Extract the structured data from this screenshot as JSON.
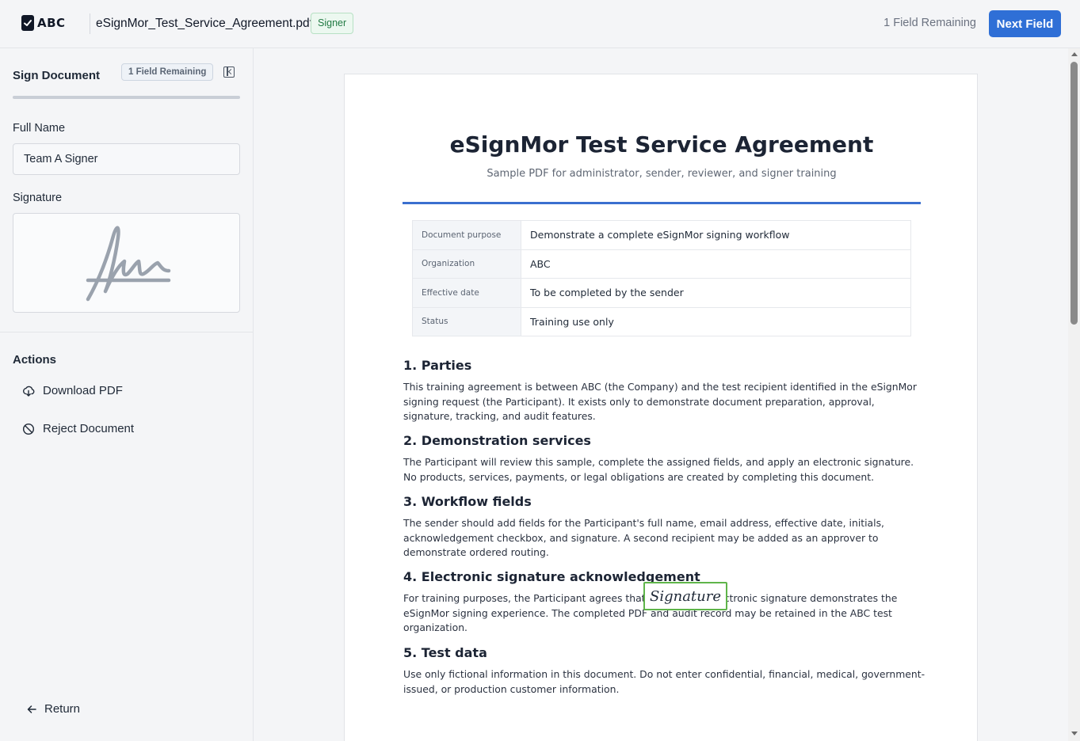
{
  "header": {
    "logo_text": "ABC",
    "filename": "eSignMor_Test_Service_Agreement.pdf",
    "role_badge": "Signer",
    "fields_remaining": "1 Field Remaining",
    "next_field_label": "Next Field"
  },
  "sidebar": {
    "title": "Sign Document",
    "remaining_badge": "1 Field Remaining",
    "full_name_label": "Full Name",
    "full_name_value": "Team A Signer",
    "signature_label": "Signature",
    "actions_title": "Actions",
    "actions": [
      {
        "label": "Download PDF",
        "icon": "download-cloud-icon"
      },
      {
        "label": "Reject Document",
        "icon": "ban-icon"
      }
    ],
    "return_label": "Return"
  },
  "document": {
    "title": "eSignMor Test Service Agreement",
    "subtitle": "Sample PDF for administrator, sender, reviewer, and signer training",
    "info_rows": [
      {
        "key": "Document purpose",
        "value": "Demonstrate a complete eSignMor signing workflow"
      },
      {
        "key": "Organization",
        "value": "ABC"
      },
      {
        "key": "Effective date",
        "value": "To be completed by the sender"
      },
      {
        "key": "Status",
        "value": "Training use only"
      }
    ],
    "sections": [
      {
        "heading": "1. Parties",
        "body": "This training agreement is between ABC (the Company) and the test recipient identified in the eSignMor signing request (the Participant). It exists only to demonstrate document preparation, approval, signature, tracking, and audit features."
      },
      {
        "heading": "2. Demonstration services",
        "body": "The Participant will review this sample, complete the assigned fields, and apply an electronic signature. No products, services, payments, or legal obligations are created by completing this document."
      },
      {
        "heading": "3. Workflow fields",
        "body": "The sender should add fields for the Participant's full name, email address, effective date, initials, acknowledgement checkbox, and signature. A second recipient may be added as an approver to demonstrate ordered routing."
      },
      {
        "heading": "4. Electronic signature acknowledgement",
        "body": "For training purposes, the Participant agrees that applying an electronic signature demonstrates the eSignMor signing experience. The completed PDF and audit record may be retained in the ABC test organization."
      },
      {
        "heading": "5. Test data",
        "body": "Use only fictional information in this document. Do not enter confidential, financial, medical, government-issued, or production customer information."
      }
    ],
    "signature_field_label": "Signature"
  },
  "colors": {
    "primary": "#2f6fd6",
    "signer_badge_bg": "#ecf8f0",
    "signer_badge_text": "#217a43",
    "signature_field_border": "#5fb54a",
    "doc_rule": "#3a6fcf"
  }
}
